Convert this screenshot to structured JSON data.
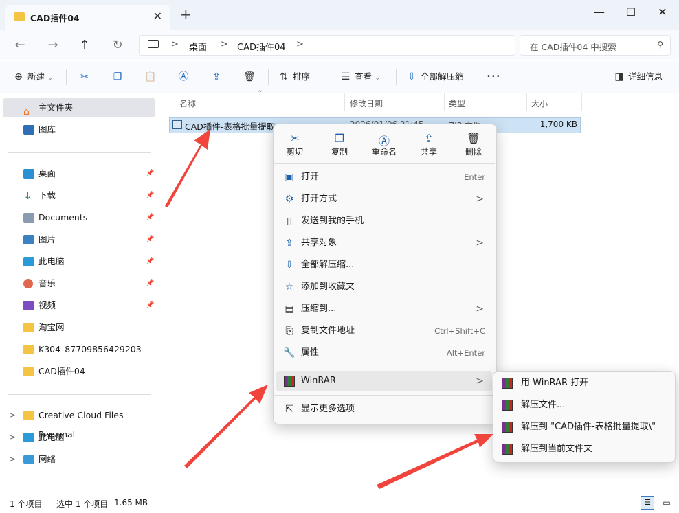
{
  "window": {
    "tab_title": "CAD插件04",
    "tab_close": "✕",
    "new_tab": "+",
    "minimize": "—",
    "maximize": "☐",
    "close": "✕"
  },
  "nav": {
    "back": "←",
    "forward": "→",
    "up": "↑",
    "refresh": "↻",
    "breadcrumb": [
      "桌面",
      "CAD插件04"
    ],
    "breadcrumb_sep": ">",
    "search_placeholder": "在 CAD插件04 中搜索"
  },
  "toolbar": {
    "new_label": "新建",
    "sort_label": "排序",
    "view_label": "查看",
    "extract_all_label": "全部解压缩",
    "more_label": "•••",
    "details_label": "详细信息"
  },
  "sidebar": {
    "home": "主文件夹",
    "gallery": "图库",
    "pinned": [
      {
        "label": "桌面"
      },
      {
        "label": "下载"
      },
      {
        "label": "Documents"
      },
      {
        "label": "图片"
      },
      {
        "label": "此电脑"
      },
      {
        "label": "音乐"
      },
      {
        "label": "视频"
      },
      {
        "label": "淘宝网"
      },
      {
        "label": "K304_87709856429203"
      },
      {
        "label": "CAD插件04"
      }
    ],
    "tree": [
      {
        "label": "Creative Cloud Files Personal"
      },
      {
        "label": "此电脑"
      },
      {
        "label": "网络"
      }
    ]
  },
  "columns": {
    "name": "名称",
    "modified": "修改日期",
    "type": "类型",
    "size": "大小"
  },
  "file": {
    "name": "CAD插件-表格批量提取",
    "modified": "2026/01/06 21:45",
    "type": "ZIP 文件",
    "size": "1,700 KB"
  },
  "context_menu": {
    "quick_actions": [
      {
        "label": "剪切",
        "icon": "✂"
      },
      {
        "label": "复制",
        "icon": "❐"
      },
      {
        "label": "重命名",
        "icon": "Ⓐ"
      },
      {
        "label": "共享",
        "icon": "⇪"
      },
      {
        "label": "删除",
        "icon": "🗑"
      }
    ],
    "items": [
      {
        "label": "打开",
        "shortcut": "Enter",
        "icon": "▣"
      },
      {
        "label": "打开方式",
        "icon": "⚙",
        "arrow": ">"
      },
      {
        "label": "发送到我的手机",
        "icon": "▯"
      },
      {
        "label": "共享对象",
        "icon": "⇪",
        "arrow": ">"
      },
      {
        "label": "全部解压缩...",
        "icon": "⇩"
      },
      {
        "label": "添加到收藏夹",
        "icon": "☆"
      },
      {
        "label": "压缩到...",
        "icon": "▤",
        "arrow": ">"
      },
      {
        "label": "复制文件地址",
        "shortcut": "Ctrl+Shift+C",
        "icon": "⎘"
      },
      {
        "label": "属性",
        "shortcut": "Alt+Enter",
        "icon": "🔧"
      }
    ],
    "winrar": {
      "label": "WinRAR",
      "arrow": ">"
    },
    "more": {
      "label": "显示更多选项",
      "icon": "⇱"
    }
  },
  "winrar_submenu": [
    {
      "label": "用 WinRAR 打开"
    },
    {
      "label": "解压文件..."
    },
    {
      "label": "解压到 \"CAD插件-表格批量提取\\\""
    },
    {
      "label": "解压到当前文件夹"
    }
  ],
  "status": {
    "count": "1 个项目",
    "selected": "选中 1 个项目",
    "size": "1.65 MB"
  },
  "colors": {
    "accent": "#1565c0",
    "arrow": "#f0443c",
    "selection": "#cde2f5"
  }
}
